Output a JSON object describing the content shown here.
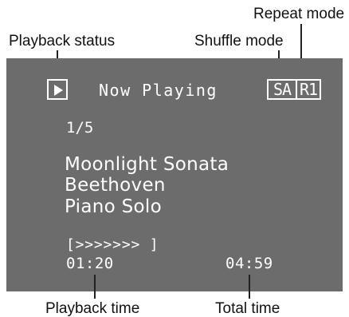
{
  "callouts": {
    "repeat_mode": "Repeat mode",
    "playback_status": "Playback status",
    "shuffle_mode": "Shuffle mode",
    "playback_time": "Playback time",
    "total_time": "Total time"
  },
  "screen": {
    "header_title": "Now Playing",
    "play_status_icon": "play-icon",
    "shuffle_indicator": "SA",
    "repeat_indicator": "R1",
    "track_position": "1/5",
    "track": {
      "title": "Moonlight Sonata",
      "artist": "Beethoven",
      "album": "Piano Solo"
    },
    "progress_bar_text": "[>>>>>>>            ]",
    "playback_time": "01:20",
    "total_time": "04:59"
  },
  "colors": {
    "screen_background": "#6c6c6c",
    "screen_text": "#ffffff",
    "callout_text": "#111111"
  }
}
